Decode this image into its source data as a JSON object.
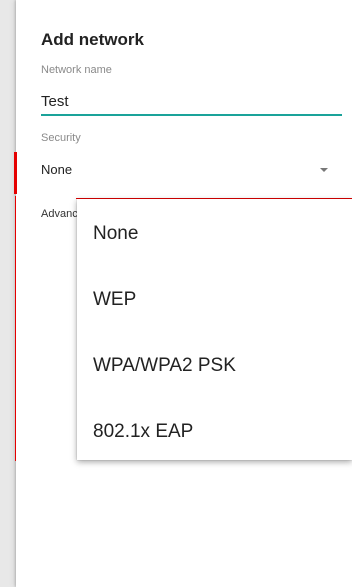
{
  "dialog": {
    "title": "Add network",
    "network_name_label": "Network name",
    "network_name_value": "Test",
    "security_label": "Security",
    "security_value": "None",
    "advanced_label": "Advanced options"
  },
  "dropdown": {
    "options": [
      "None",
      "WEP",
      "WPA/WPA2 PSK",
      "802.1x EAP"
    ]
  },
  "colors": {
    "accent": "#1aa39a",
    "highlight_red": "#e50000"
  }
}
